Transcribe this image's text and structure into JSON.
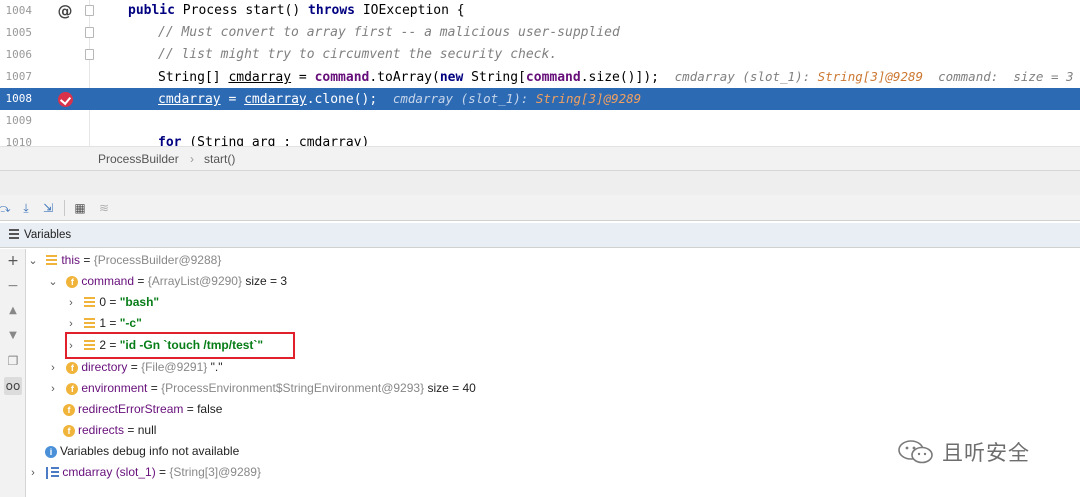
{
  "editor": {
    "lines": [
      {
        "num": "1004"
      },
      {
        "num": "1005",
        "comment": "// Must convert to array first -- a malicious user-supplied"
      },
      {
        "num": "1006",
        "comment": "// list might try to circumvent the security check."
      },
      {
        "num": "1007",
        "hint_prefix": "cmdarray (slot_1): ",
        "hint_value": "String[3]@9289",
        "hint_suffix": "  command:  size = 3"
      },
      {
        "num": "1008",
        "hint_prefix": "cmdarray (slot_1): ",
        "hint_value": "String[3]@9289"
      },
      {
        "num": "1009"
      },
      {
        "num": "1010"
      }
    ],
    "signature": {
      "public": "public",
      "type": "Process",
      "method": " start() ",
      "throws": "throws",
      "exc": " IOException {"
    },
    "line1007": {
      "pre": "String[] ",
      "var": "cmdarray",
      "eq": " = ",
      "field": "command",
      "call": ".toArray(",
      "new": "new",
      "mid": " String[",
      "field2": "command",
      "tail": ".size()]);"
    },
    "line1008": {
      "var": "cmdarray",
      "eq": " = ",
      "var2": "cmdarray",
      "tail": ".clone();"
    },
    "line1010": {
      "for": "for",
      "rest": " (String arg : cmdarray)"
    }
  },
  "breadcrumb": {
    "class": "ProcessBuilder",
    "sep": "›",
    "method": "start()"
  },
  "variables_panel": {
    "title": "Variables",
    "rows": {
      "this": {
        "name": "this",
        "type": "{ProcessBuilder@9288}"
      },
      "command": {
        "name": "command",
        "type": "{ArrayList@9290}",
        "extra": "size = 3"
      },
      "item0": {
        "name": "0",
        "value": "\"bash\""
      },
      "item1": {
        "name": "1",
        "value": "\"-c\""
      },
      "item2": {
        "name": "2",
        "value": "\"id -Gn `touch /tmp/test`\""
      },
      "directory": {
        "name": "directory",
        "type": "{File@9291}",
        "value": "\".\""
      },
      "environment": {
        "name": "environment",
        "type": "{ProcessEnvironment$StringEnvironment@9293}",
        "extra": "size = 40"
      },
      "redirectErrorStream": {
        "name": "redirectErrorStream",
        "value": "false"
      },
      "redirects": {
        "name": "redirects",
        "value": "null"
      },
      "info": {
        "text": "Variables debug info not available"
      },
      "cmdarray": {
        "name": "cmdarray (slot_1)",
        "type": "{String[3]@9289}"
      }
    }
  },
  "watermark": {
    "text": "且听安全"
  },
  "colors": {
    "highlight": "#2d6ab4",
    "keyword": "#000080",
    "string": "#067d17",
    "annotation_box": "#e0202a"
  }
}
